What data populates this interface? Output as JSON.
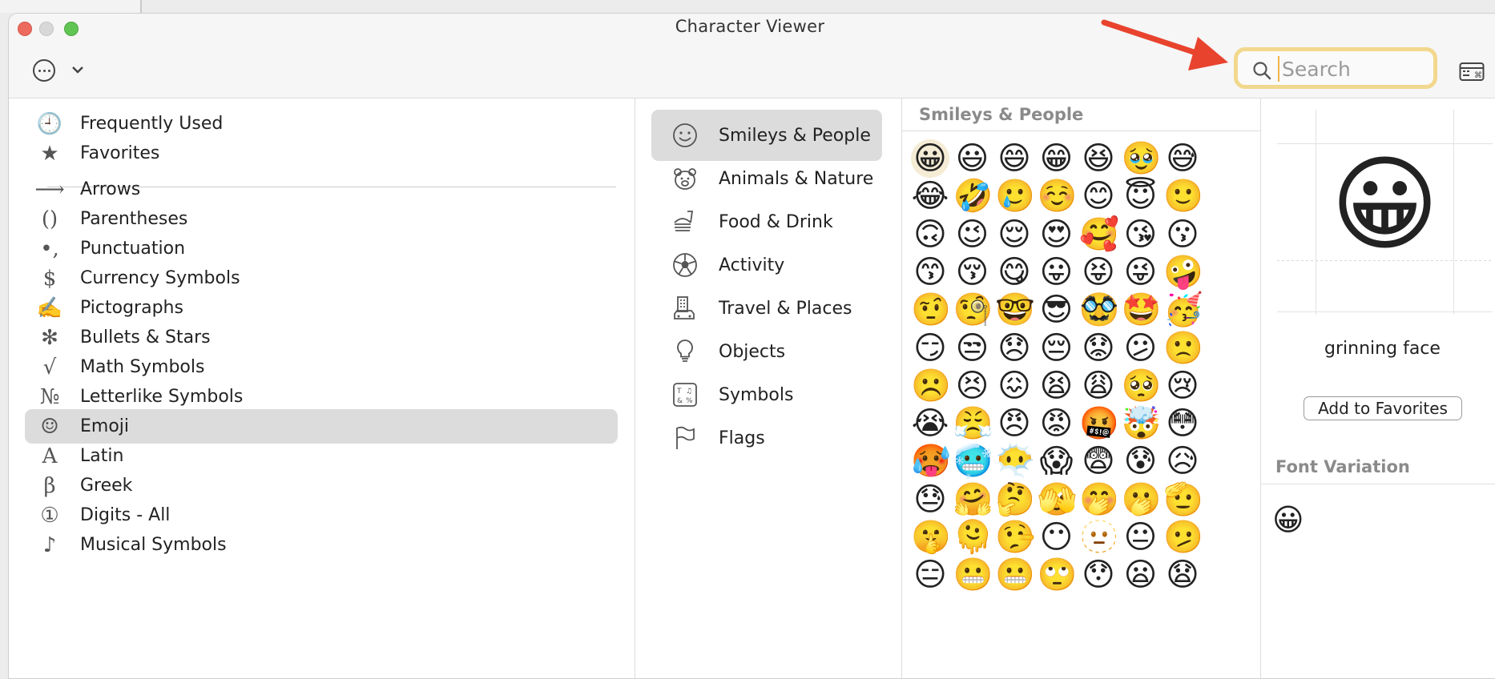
{
  "window": {
    "title": "Character Viewer"
  },
  "toolbar": {
    "more_icon": "ellipsis-circle-icon",
    "dropdown_icon": "chevron-down-icon",
    "search_placeholder": "Search",
    "search_value": "",
    "keyboard_icon": "keyboard-viewer-icon"
  },
  "annotation": {
    "arrow_color": "#e8432d",
    "search_highlight_color": "#f2d88e"
  },
  "sidebar": {
    "items": [
      {
        "icon": "clock-icon",
        "glyph": "🕘",
        "label": "Frequently Used"
      },
      {
        "icon": "star-icon",
        "glyph": "★",
        "label": "Favorites"
      },
      {
        "icon": "arrow-icon",
        "glyph": "⟶",
        "label": "Arrows"
      },
      {
        "icon": "parentheses-icon",
        "glyph": "()",
        "label": "Parentheses"
      },
      {
        "icon": "punctuation-icon",
        "glyph": "•,",
        "label": "Punctuation"
      },
      {
        "icon": "dollar-icon",
        "glyph": "$",
        "label": "Currency Symbols"
      },
      {
        "icon": "pictograph-icon",
        "glyph": "✍",
        "label": "Pictographs"
      },
      {
        "icon": "asterisk-icon",
        "glyph": "✻",
        "label": "Bullets & Stars"
      },
      {
        "icon": "square-root-icon",
        "glyph": "√",
        "label": "Math Symbols"
      },
      {
        "icon": "numero-icon",
        "glyph": "№",
        "label": "Letterlike Symbols"
      },
      {
        "icon": "smiley-icon",
        "glyph": "☺",
        "label": "Emoji"
      },
      {
        "icon": "latin-a-icon",
        "glyph": "A",
        "label": "Latin"
      },
      {
        "icon": "beta-icon",
        "glyph": "β",
        "label": "Greek"
      },
      {
        "icon": "circled-one-icon",
        "glyph": "①",
        "label": "Digits - All"
      },
      {
        "icon": "music-note-icon",
        "glyph": "♪",
        "label": "Musical Symbols"
      }
    ],
    "selected": "Emoji"
  },
  "categories": {
    "items": [
      {
        "icon": "smiley-outline-icon",
        "label": "Smileys & People"
      },
      {
        "icon": "bear-outline-icon",
        "label": "Animals & Nature"
      },
      {
        "icon": "burger-drink-icon",
        "label": "Food & Drink"
      },
      {
        "icon": "soccer-ball-icon",
        "label": "Activity"
      },
      {
        "icon": "building-car-icon",
        "label": "Travel & Places"
      },
      {
        "icon": "lightbulb-icon",
        "label": "Objects"
      },
      {
        "icon": "symbols-icon",
        "label": "Symbols"
      },
      {
        "icon": "flag-icon",
        "label": "Flags"
      }
    ],
    "selected": "Smileys & People"
  },
  "grid": {
    "title": "Smileys & People",
    "emojis": [
      "😀",
      "😃",
      "😄",
      "😁",
      "😆",
      "🥹",
      "😅",
      "😂",
      "🤣",
      "🥲",
      "☺️",
      "😊",
      "😇",
      "🙂",
      "🙃",
      "😉",
      "😌",
      "😍",
      "🥰",
      "😘",
      "😗",
      "😙",
      "😚",
      "😋",
      "😛",
      "😝",
      "😜",
      "🤪",
      "🤨",
      "🧐",
      "🤓",
      "😎",
      "🥸",
      "🤩",
      "🥳",
      "😏",
      "😒",
      "😞",
      "😔",
      "😟",
      "😕",
      "🙁",
      "☹️",
      "😣",
      "😖",
      "😫",
      "😩",
      "🥺",
      "😢",
      "😭",
      "😤",
      "😠",
      "😡",
      "🤬",
      "🤯",
      "😳",
      "🥵",
      "🥶",
      "😶‍🌫️",
      "😱",
      "😨",
      "😰",
      "😥",
      "😓",
      "🤗",
      "🤔",
      "🫣",
      "🤭",
      "🫢",
      "🫡",
      "🤫",
      "🫠",
      "🤥",
      "😶",
      "🫥",
      "😐",
      "🫤",
      "😑",
      "😬",
      "😬",
      "🙄",
      "😯",
      "😦",
      "😧"
    ],
    "selected_index": 0
  },
  "detail": {
    "emoji": "😀",
    "name": "grinning face",
    "add_favorites_label": "Add to Favorites",
    "font_variation_title": "Font Variation",
    "font_variations": [
      "😀"
    ]
  }
}
